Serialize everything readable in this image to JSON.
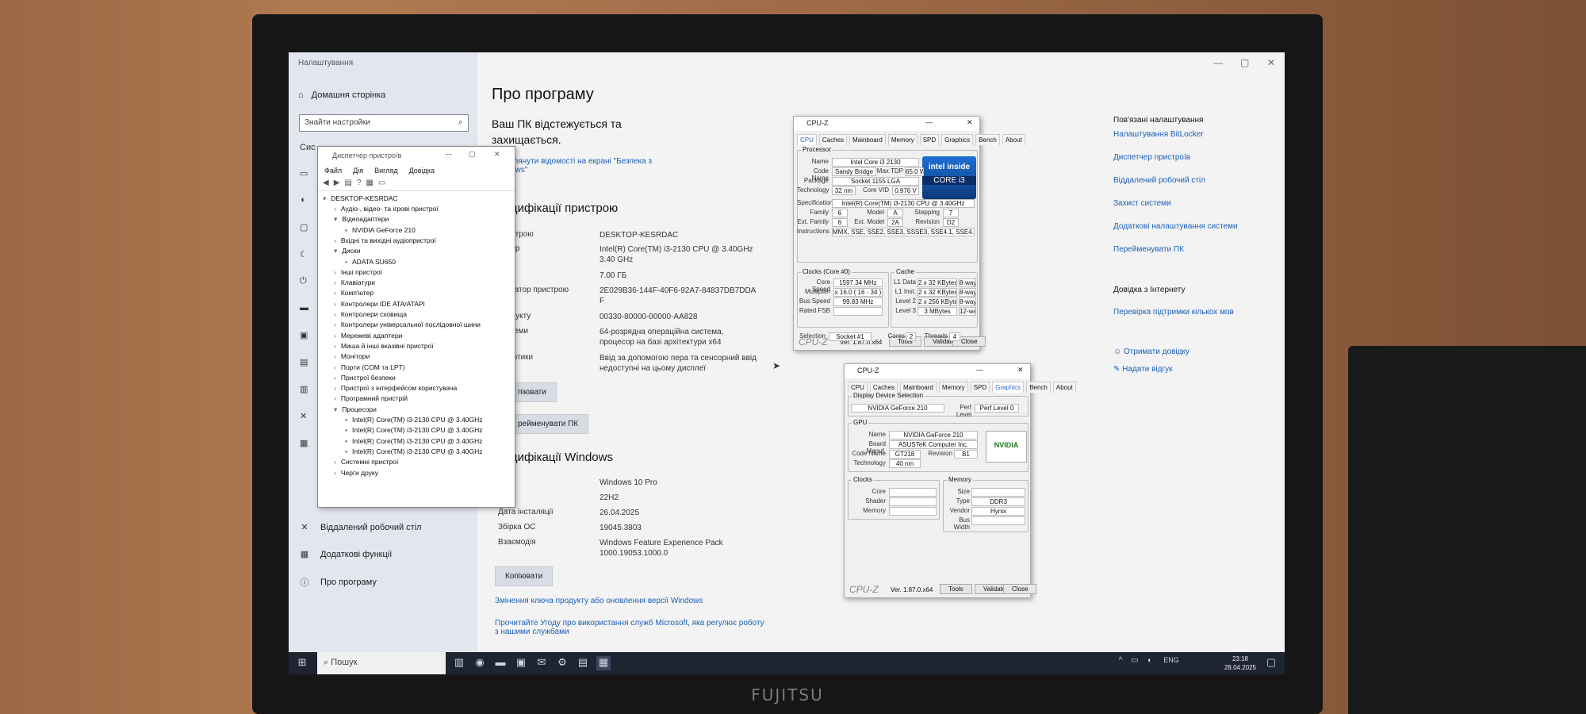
{
  "window_title": "Налаштування",
  "sidebar": {
    "home": "Домашня сторінка",
    "search_placeholder": "Знайти настройки",
    "section": "Сис",
    "items": [
      {
        "label": "Віддалений робочий стіл",
        "icon": "remote-desktop-icon"
      },
      {
        "label": "Додаткові функції",
        "icon": "apps-icon"
      },
      {
        "label": "Про програму",
        "icon": "info-icon"
      }
    ]
  },
  "main": {
    "title": "Про програму",
    "protected": "Ваш ПК відстежується та захищається.",
    "security_link": "глянути відомості на екрані \"Безпека з ows\"",
    "device_spec_title": "цифікації пристрою",
    "device_rows": [
      {
        "k": "пристрою",
        "v": "DESKTOP-KESRDAC"
      },
      {
        "k": "цесор",
        "v": "Intel(R) Core(TM) i3-2130 CPU @ 3.40GHz 3.40 GHz"
      },
      {
        "k": "",
        "v": "7.00 ГБ"
      },
      {
        "k": "ифікатор пристрою",
        "v": "2E029B36-144F-40F6-92A7-84837DB7DDA F"
      },
      {
        "k": "продукту",
        "v": "00330-80000-00000-AA828"
      },
      {
        "k": "системи",
        "v": "64-розрядна операційна система, процесор на базі архітектури x64"
      },
      {
        "k": "та дотики",
        "v": "Ввід за допомогою пера та сенсорний ввід недоступні на цьому дисплеї"
      }
    ],
    "copy_label": "піювати",
    "rename_label": "рейменувати ПК",
    "win_spec_title": "цифікації Windows",
    "win_rows": [
      {
        "k": "ск",
        "v": "Windows 10 Pro"
      },
      {
        "k": "я",
        "v": "22H2"
      },
      {
        "k": "Дата інсталяції",
        "v": "26.04.2025"
      },
      {
        "k": "Збірка ОС",
        "v": "19045.3803"
      },
      {
        "k": "Взаємодія",
        "v": "Windows Feature Experience Pack 1000.19053.1000.0"
      }
    ],
    "copy2_label": "Копіювати",
    "link1": "Змінення ключа продукту або оновлення версії Windows",
    "link2": "Прочитайте Угоду про використання служб Microsoft, яка регулює роботу з нашими службами"
  },
  "related": {
    "title": "Пов'язані налаштування",
    "links": [
      "Налаштування BitLocker",
      "Диспетчер пристроїв",
      "Віддалений робочий стіл",
      "Захист системи",
      "Додаткові налаштування системи",
      "Перейменувати ПК"
    ],
    "support_title": "Довідка з Інтернету",
    "support_link": "Перевірка підтримки кількох мов",
    "help": "Отримати довідку",
    "feedback": "Надати відгук"
  },
  "devmgr": {
    "title": "Диспетчер пристроїв",
    "menu": [
      "Файл",
      "Дія",
      "Вигляд",
      "Довідка"
    ],
    "root": "DESKTOP-KESRDAC",
    "nodes": [
      "Аудіо-, відео- та ігрові пристрої",
      "Відеоадаптери",
      "NVIDIA GeForce 210",
      "Вхідні та вихідні аудіопристрої",
      "Диски",
      "ADATA SU650",
      "Інші пристрої",
      "Клавіатури",
      "Комп'ютер",
      "Контролери IDE ATA/ATAPI",
      "Контролери сховища",
      "Контролери універсальної послідовної шини",
      "Мережеві адаптери",
      "Миша й інші вказівні пристрої",
      "Монітори",
      "Порти (COM та LPT)",
      "Пристрої безпеки",
      "Пристрої з інтерфейсом користувача",
      "Програмний пристрій",
      "Процесори",
      "Intel(R) Core(TM) i3-2130 CPU @ 3.40GHz",
      "Intel(R) Core(TM) i3-2130 CPU @ 3.40GHz",
      "Intel(R) Core(TM) i3-2130 CPU @ 3.40GHz",
      "Intel(R) Core(TM) i3-2130 CPU @ 3.40GHz",
      "Системні пристрої",
      "Черги друку"
    ]
  },
  "cpuz1": {
    "title": "CPU-Z",
    "tabs": [
      "CPU",
      "Caches",
      "Mainboard",
      "Memory",
      "SPD",
      "Graphics",
      "Bench",
      "About"
    ],
    "processor_label": "Processor",
    "name": "Intel Core i3 2130",
    "code_name": "Sandy Bridge",
    "max_tdp": "65.0 W",
    "package": "Socket 1155 LGA",
    "technology": "32 nm",
    "core_vid": "0.976 V",
    "specification": "Intel(R) Core(TM) i3-2130 CPU @ 3.40GHz",
    "family": "6",
    "model": "A",
    "stepping": "7",
    "ext_family": "6",
    "ext_model": "2A",
    "revision": "D2",
    "instructions": "MMX, SSE, SSE2, SSE3, SSSE3, SSE4.1, SSE4.2, EM64T, VT-x, AVX",
    "clocks_label": "Clocks (Core #0)",
    "core_speed": "1597.34 MHz",
    "multiplier": "x 16.0 ( 16 - 34 )",
    "bus_speed": "99.83 MHz",
    "rated_fsb": "",
    "cache_label": "Cache",
    "l1d": "2 x 32 KBytes",
    "l1d_way": "8-way",
    "l1i": "2 x 32 KBytes",
    "l1i_way": "8-way",
    "l2": "2 x 256 KBytes",
    "l2_way": "8-way",
    "l3": "3 MBytes",
    "l3_way": "12-way",
    "selection": "Socket #1",
    "cores": "2",
    "threads": "4",
    "logo": "CPU-Z",
    "ver": "Ver. 1.87.0.x64",
    "tools": "Tools",
    "validate": "Validate",
    "close": "Close",
    "intel_badge": "intel inside",
    "core_badge": "CORE i3",
    "lbl": {
      "name": "Name",
      "code": "Code Name",
      "tdp": "Max TDP",
      "pkg": "Package",
      "tech": "Technology",
      "vid": "Core VID",
      "spec": "Specification",
      "fam": "Family",
      "model": "Model",
      "step": "Stepping",
      "extfam": "Ext. Family",
      "extmod": "Ext. Model",
      "rev": "Revision",
      "instr": "Instructions",
      "cs": "Core Speed",
      "mul": "Multiplier",
      "bus": "Bus Speed",
      "fsb": "Rated FSB",
      "l1d": "L1 Data",
      "l1i": "L1 Inst.",
      "l2": "Level 2",
      "l3": "Level 3",
      "sel": "Selection",
      "cores": "Cores",
      "threads": "Threads"
    }
  },
  "cpuz2": {
    "title": "CPU-Z",
    "tabs": [
      "CPU",
      "Caches",
      "Mainboard",
      "Memory",
      "SPD",
      "Graphics",
      "Bench",
      "About"
    ],
    "dds_label": "Display Device Selection",
    "device": "NVIDIA GeForce 210",
    "perf_label": "Perf Level",
    "perf": "Perf Level 0",
    "gpu_label": "GPU",
    "name": "NVIDIA GeForce 210",
    "board": "ASUSTeK Computer Inc.",
    "code": "GT218",
    "revision": "B1",
    "technology": "40 nm",
    "clocks_label": "Clocks",
    "memory_label": "Memory",
    "mem_type": "DDR3",
    "mem_vendor": "Hynix",
    "logo": "CPU-Z",
    "ver": "Ver. 1.87.0.x64",
    "tools": "Tools",
    "validate": "Validate",
    "close": "Close",
    "nvidia": "NVIDIA",
    "lbl": {
      "name": "Name",
      "board": "Board Manuf.",
      "code": "Code Name",
      "rev": "Revision",
      "tech": "Technology",
      "core": "Core",
      "shader": "Shader",
      "memory": "Memory",
      "size": "Size",
      "type": "Type",
      "vendor": "Vendor",
      "bw": "Bus Width"
    }
  },
  "taskbar": {
    "search": "Пошук",
    "lang": "ENG",
    "time": "23:18",
    "date": "28.04.2025"
  },
  "monitor_brand": "FUJITSU"
}
